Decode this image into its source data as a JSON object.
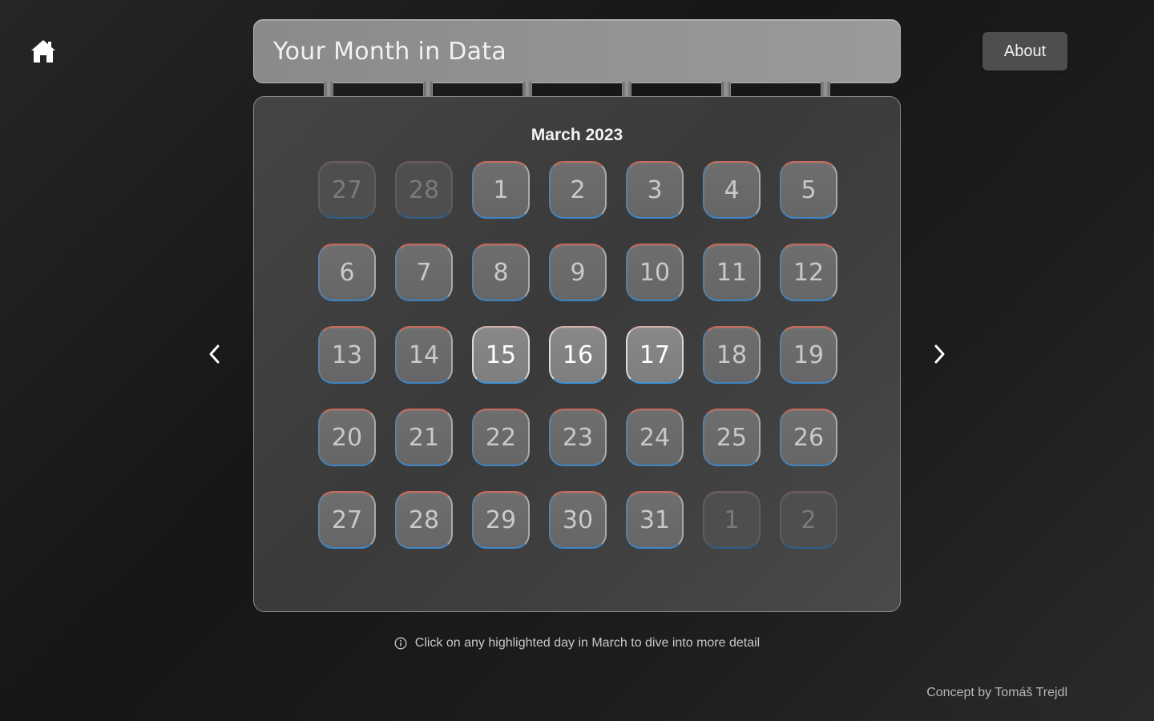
{
  "header": {
    "title": "Your Month in Data",
    "about_label": "About"
  },
  "calendar": {
    "month_label": "March 2023",
    "days": [
      {
        "label": "27",
        "state": "outside"
      },
      {
        "label": "28",
        "state": "outside"
      },
      {
        "label": "1",
        "state": "normal"
      },
      {
        "label": "2",
        "state": "normal"
      },
      {
        "label": "3",
        "state": "normal"
      },
      {
        "label": "4",
        "state": "normal"
      },
      {
        "label": "5",
        "state": "normal"
      },
      {
        "label": "6",
        "state": "normal"
      },
      {
        "label": "7",
        "state": "normal"
      },
      {
        "label": "8",
        "state": "normal"
      },
      {
        "label": "9",
        "state": "normal"
      },
      {
        "label": "10",
        "state": "normal"
      },
      {
        "label": "11",
        "state": "normal"
      },
      {
        "label": "12",
        "state": "normal"
      },
      {
        "label": "13",
        "state": "normal"
      },
      {
        "label": "14",
        "state": "normal"
      },
      {
        "label": "15",
        "state": "highlight"
      },
      {
        "label": "16",
        "state": "highlight"
      },
      {
        "label": "17",
        "state": "highlight"
      },
      {
        "label": "18",
        "state": "normal"
      },
      {
        "label": "19",
        "state": "normal"
      },
      {
        "label": "20",
        "state": "normal"
      },
      {
        "label": "21",
        "state": "normal"
      },
      {
        "label": "22",
        "state": "normal"
      },
      {
        "label": "23",
        "state": "normal"
      },
      {
        "label": "24",
        "state": "normal"
      },
      {
        "label": "25",
        "state": "normal"
      },
      {
        "label": "26",
        "state": "normal"
      },
      {
        "label": "27",
        "state": "normal"
      },
      {
        "label": "28",
        "state": "normal"
      },
      {
        "label": "29",
        "state": "normal"
      },
      {
        "label": "30",
        "state": "normal"
      },
      {
        "label": "31",
        "state": "normal"
      },
      {
        "label": "1",
        "state": "outside"
      },
      {
        "label": "2",
        "state": "outside"
      }
    ]
  },
  "hint": {
    "icon": "info-icon",
    "text": "Click on any highlighted day in March to dive into more detail"
  },
  "footer": {
    "credit": "Concept by Tomáš Trejdl"
  },
  "icons": {
    "home": "home-icon",
    "prev": "chevron-left-icon",
    "next": "chevron-right-icon"
  }
}
